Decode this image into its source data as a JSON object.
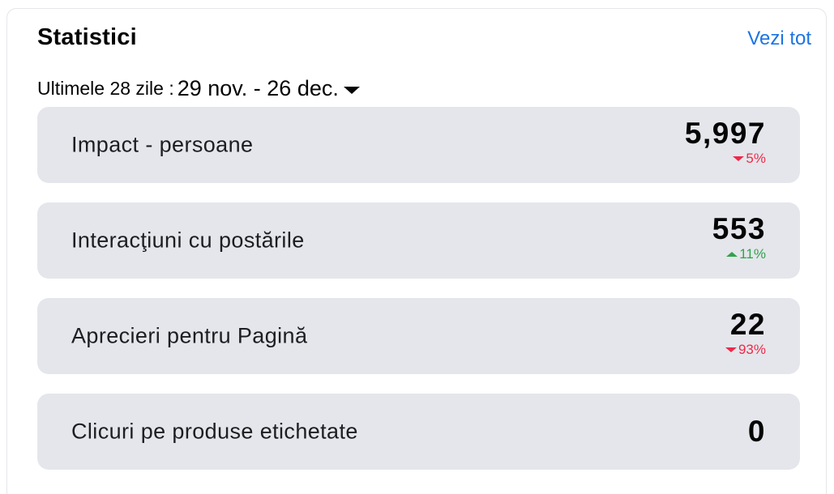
{
  "header": {
    "title": "Statistici",
    "see_all": "Vezi tot"
  },
  "range": {
    "label": "Ultimele 28 zile :",
    "dates": "29 nov. - 26 dec.",
    "icon": "caret-down-icon"
  },
  "colors": {
    "accent": "#1b74e4",
    "down": "#f02849",
    "up": "#31a24c",
    "row_bg": "#e4e6eb"
  },
  "metrics": [
    {
      "label": "Impact - persoane",
      "value": "5,997",
      "change": "5%",
      "direction": "down"
    },
    {
      "label": "Interacţiuni cu postările",
      "value": "553",
      "change": "11%",
      "direction": "up"
    },
    {
      "label": "Aprecieri pentru Pagină",
      "value": "22",
      "change": "93%",
      "direction": "down"
    },
    {
      "label": "Clicuri pe produse etichetate",
      "value": "0",
      "change": "",
      "direction": ""
    }
  ]
}
